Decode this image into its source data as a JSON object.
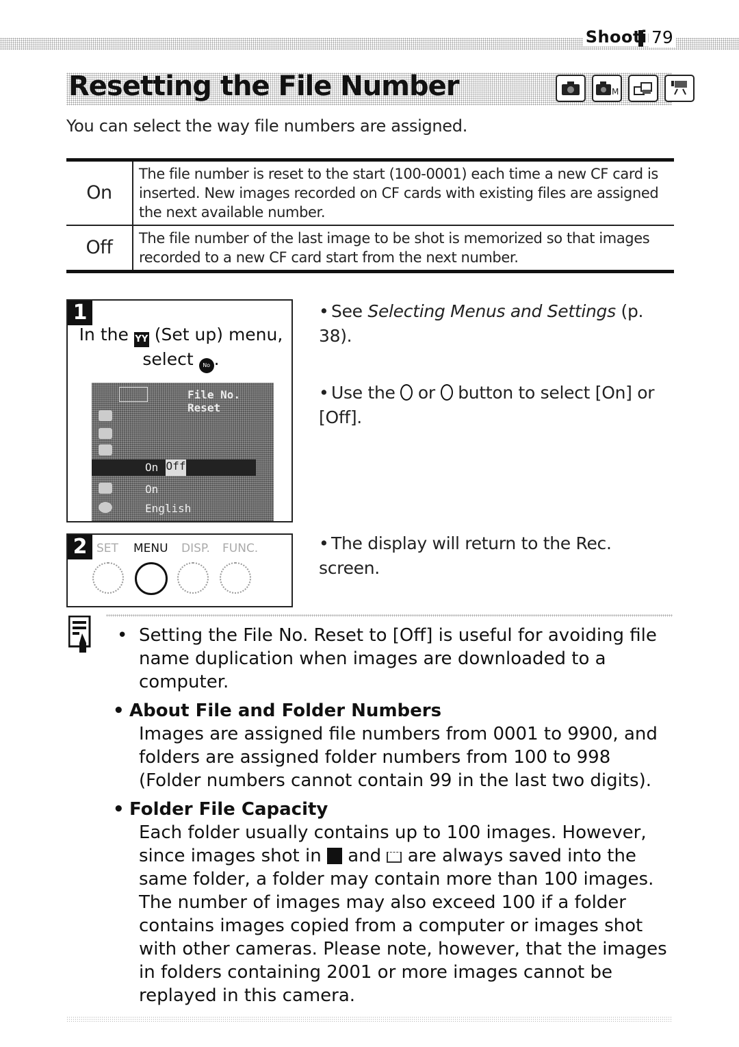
{
  "header": {
    "section": "Shooting",
    "page_number": "79"
  },
  "title": "Resetting the File Number",
  "mode_icons": [
    "auto-mode-icon",
    "manual-mode-icon",
    "stitch-assist-icon",
    "movie-mode-icon"
  ],
  "intro": "You can select the way file numbers are assigned.",
  "settings_table": [
    {
      "option": "On",
      "description": "The file number is reset to the start (100-0001) each time a new CF card is inserted. New images recorded on CF cards with existing files are assigned the next available number."
    },
    {
      "option": "Off",
      "description": "The file number of the last image to be shot is memorized so that images recorded to a new CF card start from the next number."
    }
  ],
  "steps": [
    {
      "number": "1",
      "instruction_prefix": "In the",
      "instruction_icon": "setup-menu-icon",
      "instruction_middle": "(Set up) menu,",
      "instruction_select": "select",
      "instruction_icon2": "file-no-reset-icon",
      "lcd": {
        "title": "File No. Reset",
        "rows": [
          "On",
          "Off",
          "On",
          "English"
        ],
        "selected": "Off"
      },
      "bullets": [
        {
          "prefix": "See ",
          "italic": "Selecting Menus and Settings",
          "suffix": " (p. 38)."
        },
        {
          "text_before": "Use the",
          "text_mid": "or",
          "text_after": "button to select [On] or [Off]."
        }
      ]
    },
    {
      "number": "2",
      "buttons": [
        "SET",
        "MENU",
        "DISP.",
        "FUNC."
      ],
      "pressed": "MENU",
      "bullets": [
        {
          "text": "The display will return to the Rec. screen."
        }
      ]
    }
  ],
  "note": {
    "bullet": "Setting the File No. Reset to [Off] is useful for avoiding file name duplication when images are downloaded to a computer.",
    "sections": [
      {
        "heading": "About File and Folder Numbers",
        "body": "Images are assigned file numbers from 0001 to 9900, and folders are assigned folder numbers from 100 to 998 (Folder numbers cannot contain 99 in the last two digits)."
      },
      {
        "heading": "Folder File Capacity",
        "body_before": "Each folder usually contains up to 100 images. However, since images shot in",
        "body_mid": "and",
        "body_after": "are always saved into the same folder, a folder may contain more than 100 images. The number of images may also exceed 100 if a folder contains images copied from a computer or images shot with other cameras. Please note, however, that the images in folders containing 2001 or more images cannot be replayed in this camera."
      }
    ]
  }
}
